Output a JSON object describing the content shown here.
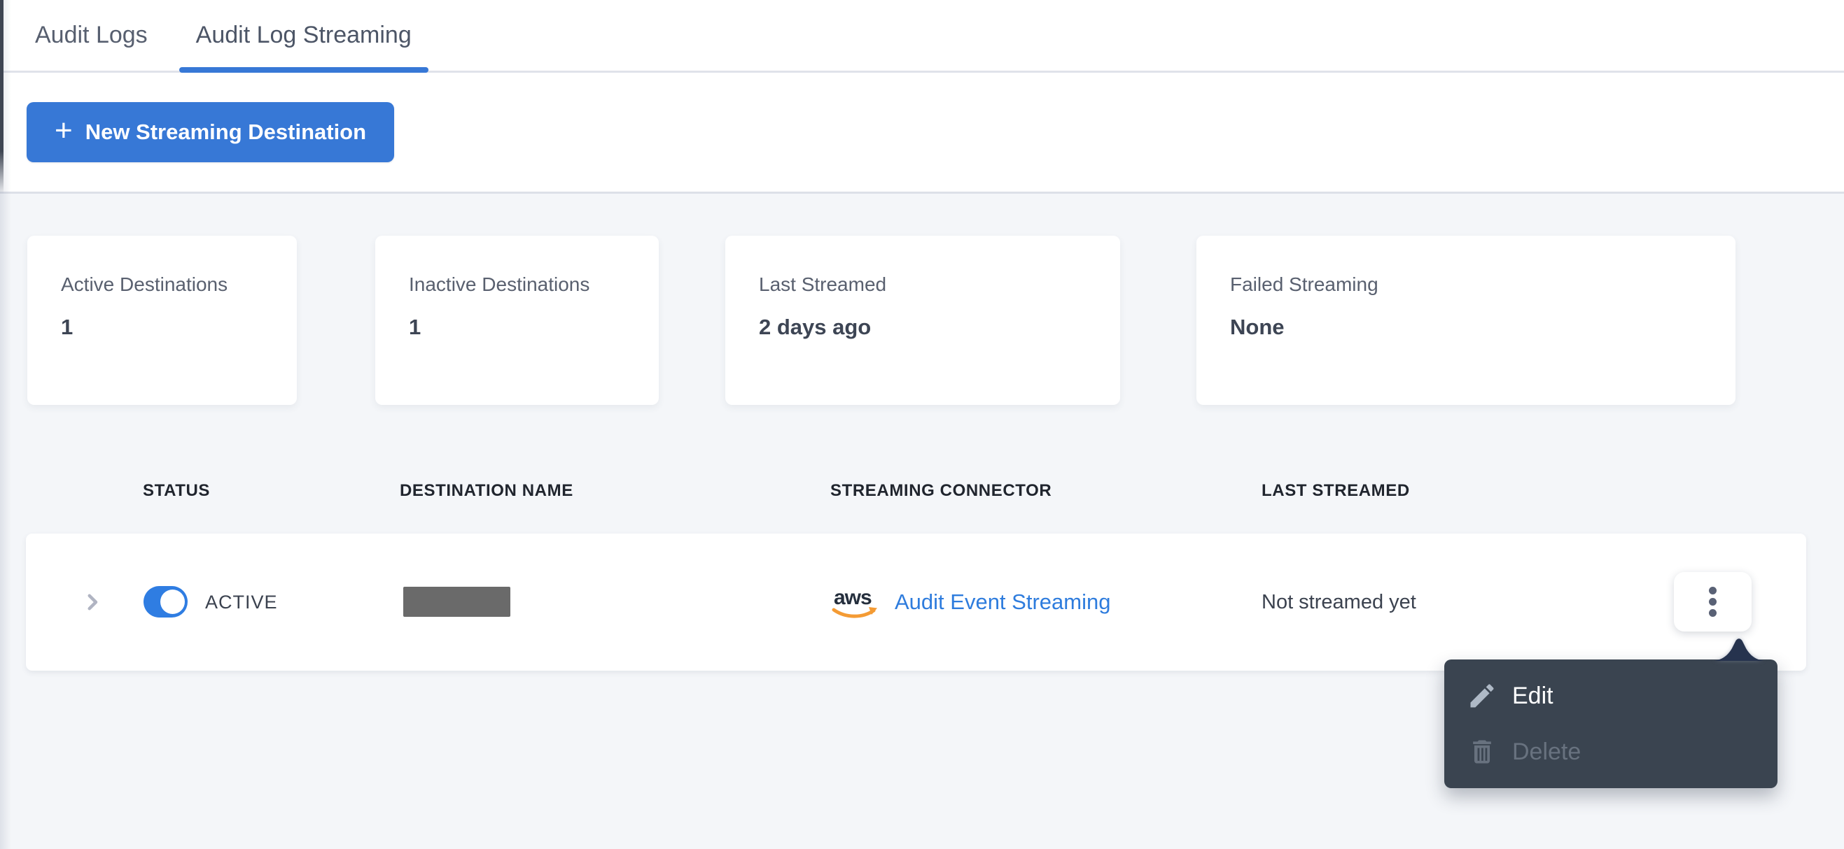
{
  "tabs": {
    "items": [
      {
        "label": "Audit Logs",
        "active": false
      },
      {
        "label": "Audit Log Streaming",
        "active": true
      }
    ]
  },
  "toolbar": {
    "plus": "+",
    "new_streaming_destination_label": "New Streaming Destination"
  },
  "stats": {
    "cards": [
      {
        "label": "Active Destinations",
        "value": "1"
      },
      {
        "label": "Inactive Destinations",
        "value": "1"
      },
      {
        "label": "Last Streamed",
        "value": "2 days ago"
      },
      {
        "label": "Failed Streaming",
        "value": "None"
      }
    ]
  },
  "table": {
    "headers": [
      "STATUS",
      "DESTINATION NAME",
      "STREAMING CONNECTOR",
      "LAST STREAMED"
    ],
    "row": {
      "status_label": "ACTIVE",
      "toggle_state": "on",
      "destination_name": "redacted",
      "connector_brand": "aws",
      "connector_label": "Audit Event Streaming",
      "last_streamed": "Not streamed yet"
    }
  },
  "context_menu": {
    "items": [
      {
        "label": "Edit",
        "icon": "pencil-icon",
        "enabled": true
      },
      {
        "label": "Delete",
        "icon": "trash-icon",
        "enabled": false
      }
    ]
  },
  "colors": {
    "accent_blue": "#3778d6",
    "link_blue": "#2e7cdd",
    "toggle_blue": "#2f7de2",
    "menu_background": "#3a4450",
    "menu_arrow": "#26334e",
    "aws_navy": "#252f3d",
    "aws_orange": "#f49b34",
    "page_background": "#f4f6f9"
  }
}
